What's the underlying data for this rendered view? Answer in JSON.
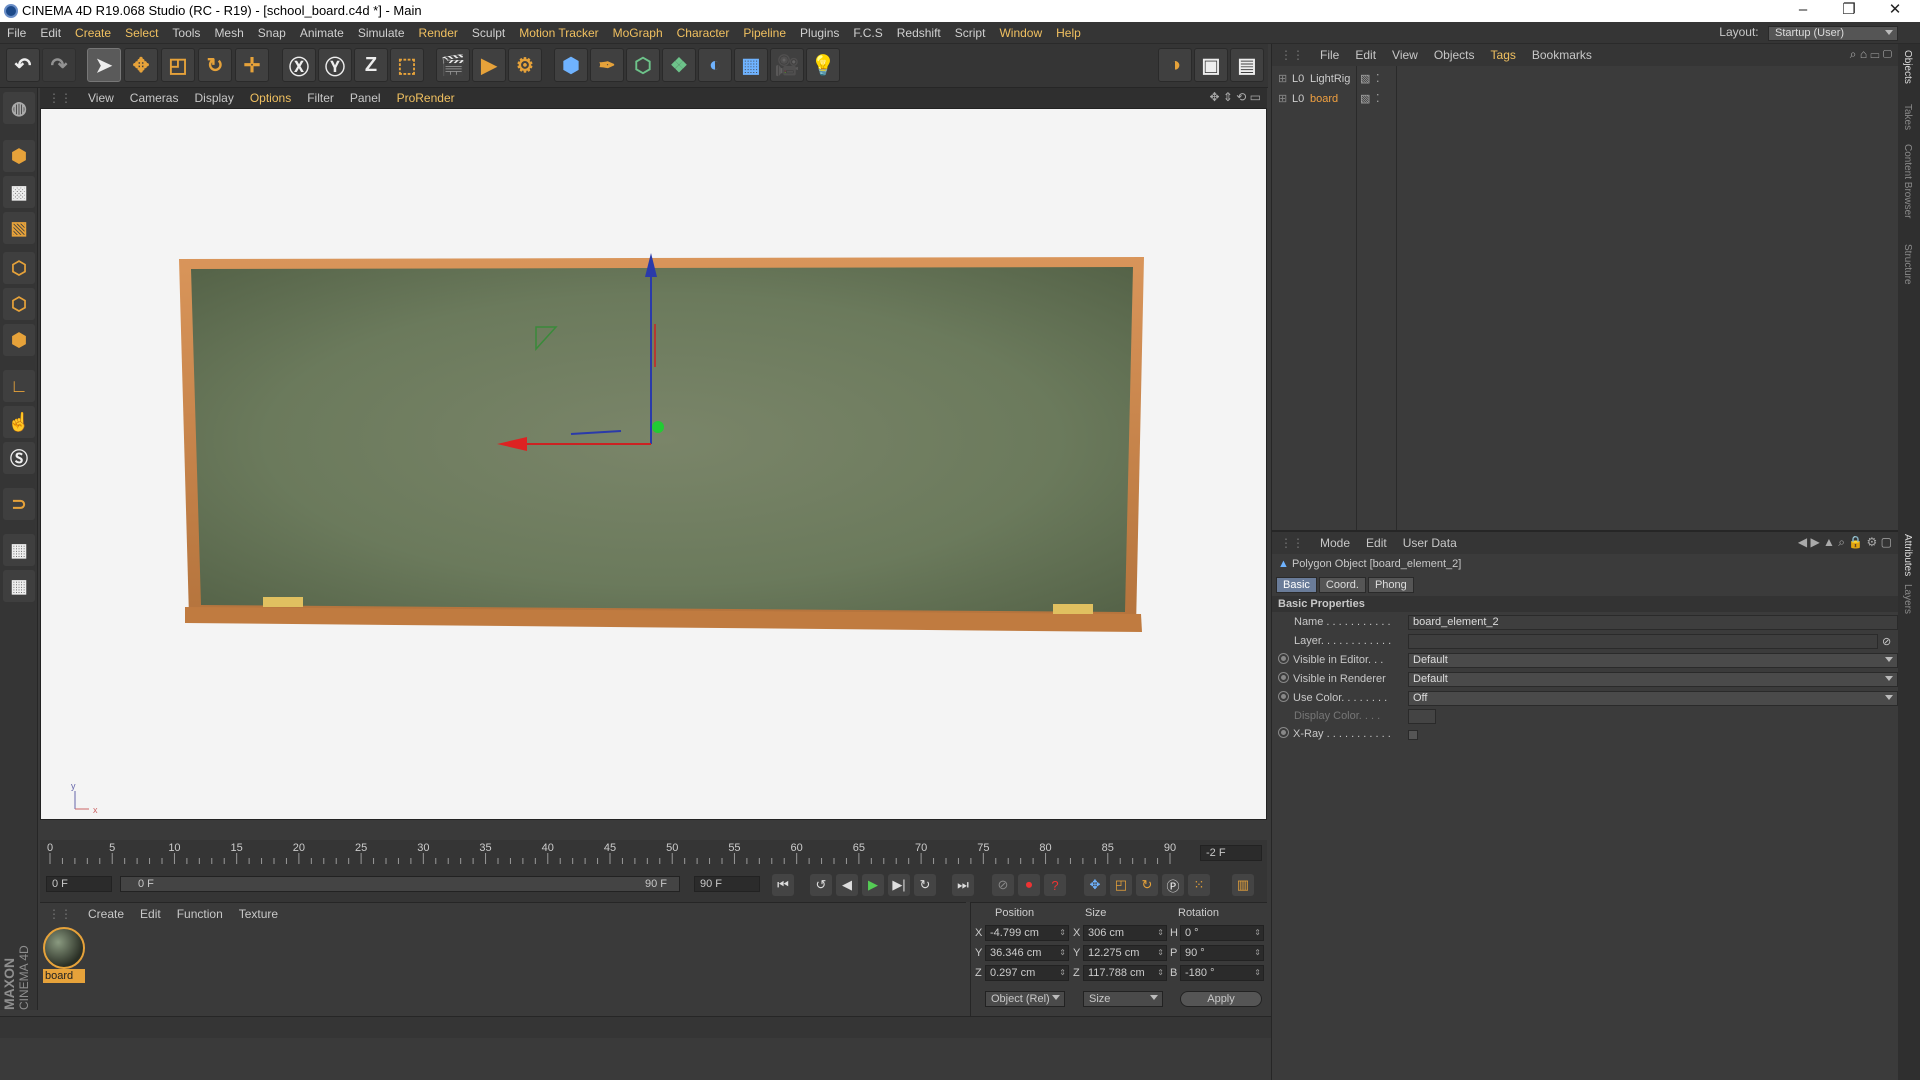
{
  "window": {
    "title": "CINEMA 4D R19.068 Studio (RC - R19) - [school_board.c4d *] - Main",
    "minimize": "–",
    "maximize": "❐",
    "close": "✕"
  },
  "menubar": {
    "items": [
      "File",
      "Edit",
      "Create",
      "Select",
      "Tools",
      "Mesh",
      "Snap",
      "Animate",
      "Simulate",
      "Render",
      "Sculpt",
      "Motion Tracker",
      "MoGraph",
      "Character",
      "Pipeline",
      "Plugins",
      "F.C.S",
      "Redshift",
      "Script",
      "Window",
      "Help"
    ],
    "highlighted": [
      "Create",
      "Select",
      "Render",
      "Motion Tracker",
      "MoGraph",
      "Character",
      "Pipeline",
      "Window",
      "Help"
    ],
    "layout_label": "Layout:",
    "layout_value": "Startup (User)"
  },
  "viewport": {
    "menu": [
      "View",
      "Cameras",
      "Display",
      "Options",
      "Filter",
      "Panel",
      "ProRender"
    ],
    "highlighted": [
      "Options",
      "ProRender"
    ],
    "axis_y": "y",
    "axis_x": "x"
  },
  "timeline": {
    "ticks": [
      "0",
      "5",
      "10",
      "15",
      "20",
      "25",
      "30",
      "35",
      "40",
      "45",
      "50",
      "55",
      "60",
      "65",
      "70",
      "75",
      "80",
      "85",
      "90"
    ],
    "current_frame": "-2 F",
    "start": "0 F",
    "range_start": "0 F",
    "range_end": "90 F",
    "end": "90 F"
  },
  "material_manager": {
    "menu": [
      "Create",
      "Edit",
      "Function",
      "Texture"
    ],
    "materials": [
      {
        "name": "board"
      }
    ]
  },
  "coordinates": {
    "headers": {
      "position": "Position",
      "size": "Size",
      "rotation": "Rotation"
    },
    "rows": [
      {
        "axis": "X",
        "pos": "-4.799 cm",
        "size_axis": "X",
        "size": "306 cm",
        "rot_axis": "H",
        "rot": "0 °"
      },
      {
        "axis": "Y",
        "pos": "36.346 cm",
        "size_axis": "Y",
        "size": "12.275 cm",
        "rot_axis": "P",
        "rot": "90 °"
      },
      {
        "axis": "Z",
        "pos": "0.297 cm",
        "size_axis": "Z",
        "size": "117.788 cm",
        "rot_axis": "B",
        "rot": "-180 °"
      }
    ],
    "mode": "Object (Rel)",
    "size_mode": "Size",
    "apply": "Apply"
  },
  "object_manager": {
    "menu": [
      "File",
      "Edit",
      "View",
      "Objects",
      "Tags",
      "Bookmarks"
    ],
    "highlighted": [
      "Tags"
    ],
    "objects": [
      {
        "name": "LightRig",
        "active": false
      },
      {
        "name": "board",
        "active": true
      }
    ]
  },
  "attribute_manager": {
    "menu": [
      "Mode",
      "Edit",
      "User Data"
    ],
    "object_title": "Polygon Object [board_element_2]",
    "tabs": [
      "Basic",
      "Coord.",
      "Phong"
    ],
    "section": "Basic Properties",
    "properties": {
      "name_label": "Name . . . . . . . . . . .",
      "name_value": "board_element_2",
      "layer_label": "Layer. . . . . . . . . . . .",
      "vis_editor_label": "Visible in Editor. . .",
      "vis_editor_value": "Default",
      "vis_render_label": "Visible in Renderer",
      "vis_render_value": "Default",
      "use_color_label": "Use Color. . . . . . . .",
      "use_color_value": "Off",
      "display_color_label": "Display Color. . . .",
      "xray_label": "X-Ray . . . . . . . . . . ."
    }
  },
  "side_tabs": [
    "Objects",
    "Takes",
    "Content Browser",
    "Structure",
    "Attributes",
    "Layers"
  ],
  "brand": {
    "line1": "MAXON",
    "line2": "CINEMA 4D"
  },
  "colors": {
    "accent": "#f0c060",
    "viewport_bg": "#f4f4f4",
    "board_green": "#6b7a5c",
    "frame_wood": "#c9874a"
  }
}
